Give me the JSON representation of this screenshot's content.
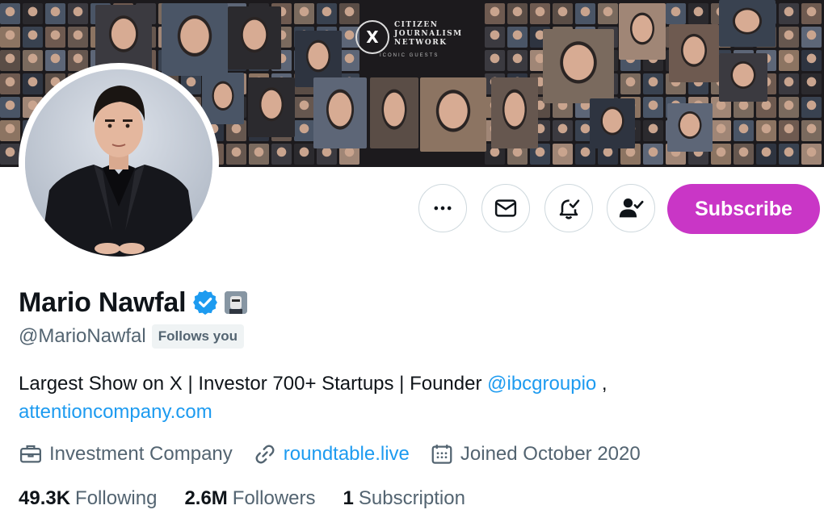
{
  "banner": {
    "logo_title": "CITIZEN JOURNALISM NETWORK",
    "logo_subtitle": "ICONIC GUESTS",
    "logo_mark": "X"
  },
  "actions": {
    "more_icon": "more-icon",
    "message_icon": "mail-icon",
    "notify_icon": "bell-check-icon",
    "following_icon": "person-check-icon",
    "subscribe_label": "Subscribe",
    "subscribe_color": "#c936c6"
  },
  "profile": {
    "name": "Mario Nawfal",
    "handle": "@MarioNawfal",
    "follows_you": "Follows you",
    "bio_text": "Largest Show on X | Investor 700+ Startups | Founder ",
    "bio_mention": "@ibcgroupio",
    "bio_sep": " ,",
    "bio_link": "attentioncompany.com",
    "link_color": "#1d9bf0"
  },
  "meta": {
    "category": "Investment Company",
    "website": "roundtable.live",
    "joined": "Joined October 2020"
  },
  "stats": {
    "following_count": "49.3K",
    "following_label": "Following",
    "followers_count": "2.6M",
    "followers_label": "Followers",
    "subscriptions_count": "1",
    "subscriptions_label": "Subscription"
  }
}
